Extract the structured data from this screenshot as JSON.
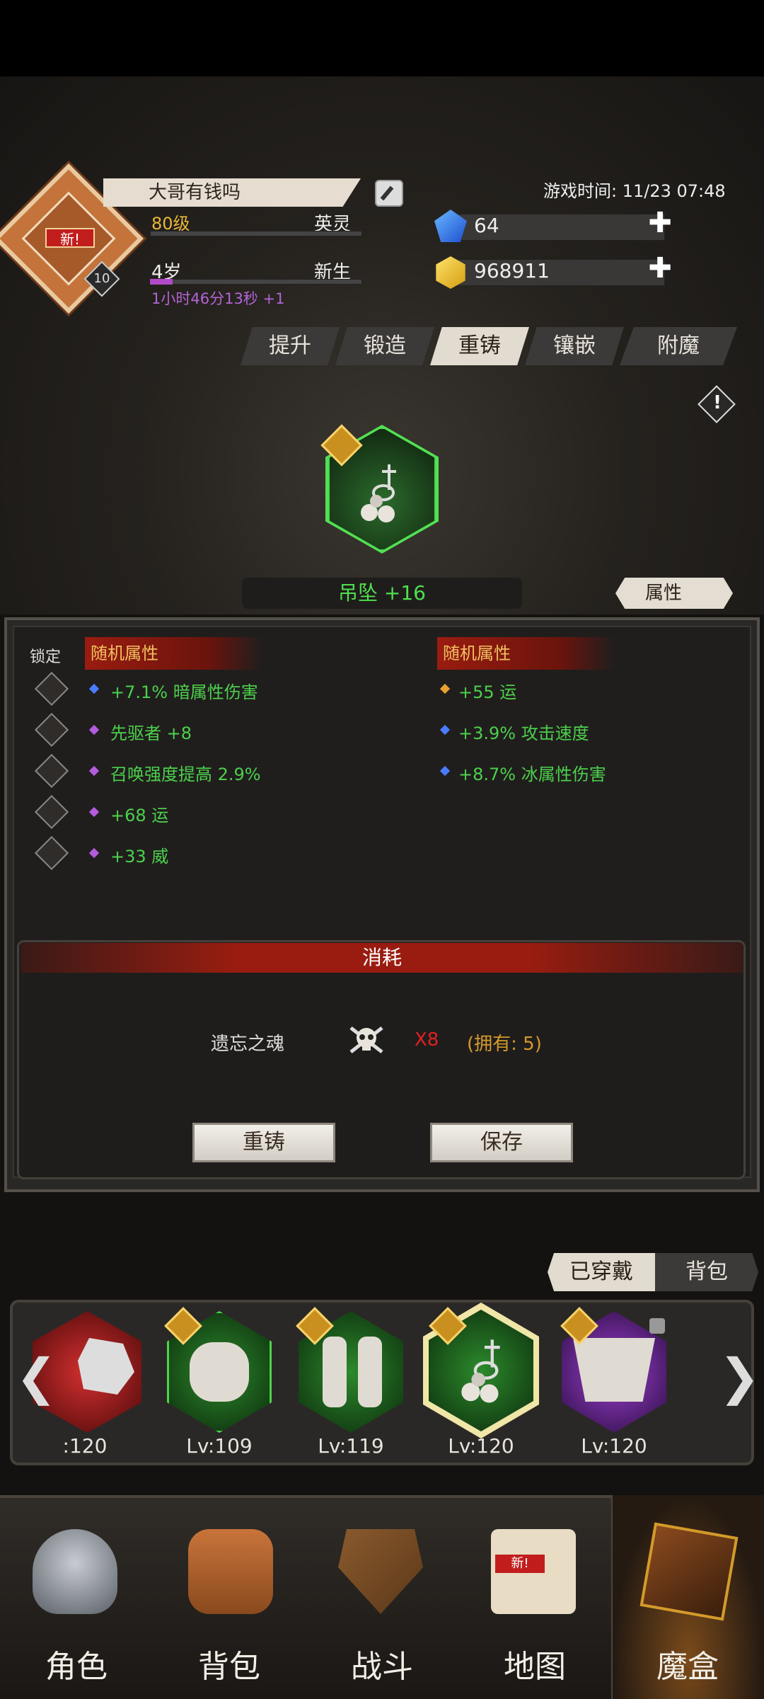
{
  "header": {
    "avatar_badge": "新!",
    "avatar_level": "10",
    "player_name": "大哥有钱吗",
    "level": "80级",
    "class_name": "英灵",
    "age": "4岁",
    "life_stage": "新生",
    "age_timer": "1小时46分13秒 +1",
    "game_time": "游戏时间: 11/23 07:48",
    "gems": "64",
    "gold": "968911",
    "plus": "✚"
  },
  "tabs": [
    "提升",
    "锻造",
    "重铸",
    "镶嵌",
    "附魔"
  ],
  "active_tab": "重铸",
  "item": {
    "name": "吊坠 +16",
    "attr_button": "属性"
  },
  "attributes": {
    "lock_label": "锁定",
    "left_title": "随机属性",
    "right_title": "随机属性",
    "left": [
      {
        "text": "+7.1% 暗属性伤害",
        "gem_color": "#4a7cff"
      },
      {
        "text": "先驱者 +8",
        "gem_color": "#b45ce0"
      },
      {
        "text": "召唤强度提高 2.9%",
        "gem_color": "#b45ce0"
      },
      {
        "text": "+68 运",
        "gem_color": "#b45ce0"
      },
      {
        "text": "+33 威",
        "gem_color": "#b45ce0"
      }
    ],
    "right": [
      {
        "text": "+55 运",
        "gem_color": "#e8a030"
      },
      {
        "text": "+3.9% 攻击速度",
        "gem_color": "#4a7cff"
      },
      {
        "text": "+8.7% 冰属性伤害",
        "gem_color": "#4a7cff"
      }
    ]
  },
  "cost": {
    "title": "消耗",
    "material": "遗忘之魂",
    "quantity": "X8",
    "owned": "(拥有: 5)"
  },
  "buttons": {
    "reforge": "重铸",
    "save": "保存"
  },
  "equip_tabs": {
    "equipped": "已穿戴",
    "bag": "背包"
  },
  "equipment": [
    {
      "level": ":120",
      "frame": "red"
    },
    {
      "level": "Lv:109",
      "frame": "green"
    },
    {
      "level": "Lv:119",
      "frame": "green"
    },
    {
      "level": "Lv:120",
      "frame": "green-selected"
    },
    {
      "level": "Lv:120",
      "frame": "purple"
    }
  ],
  "nav": {
    "items": [
      "角色",
      "背包",
      "战斗",
      "地图",
      "魔盒"
    ],
    "map_badge": "新!",
    "active": "魔盒"
  },
  "arrows": {
    "left": "❮",
    "right": "❯"
  }
}
